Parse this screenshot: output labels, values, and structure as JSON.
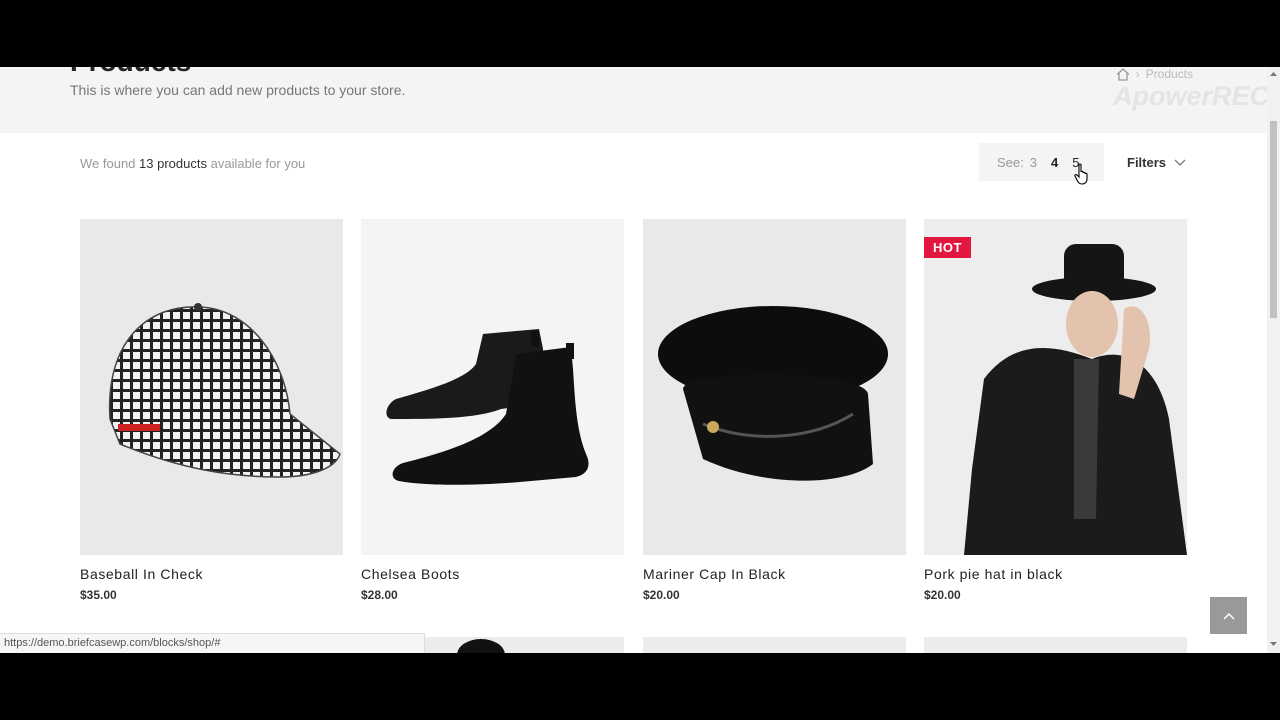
{
  "header": {
    "title": "Products",
    "subtitle": "This is where you can add new products to your store.",
    "breadcrumb": {
      "home_icon": "home-icon",
      "current": "Products"
    },
    "watermark": "ApowerREC"
  },
  "toolbar": {
    "found_prefix": "We found",
    "found_count": "13 products",
    "found_suffix": "available for you",
    "see_label": "See:",
    "see_options": [
      "3",
      "4",
      "5"
    ],
    "see_active": "4",
    "filters_label": "Filters"
  },
  "products": [
    {
      "name": "Baseball In Check",
      "price": "$35.00",
      "badge": ""
    },
    {
      "name": "Chelsea Boots",
      "price": "$28.00",
      "badge": ""
    },
    {
      "name": "Mariner Cap In Black",
      "price": "$20.00",
      "badge": ""
    },
    {
      "name": "Pork pie hat in black",
      "price": "$20.00",
      "badge": "HOT"
    }
  ],
  "status_bar": {
    "url": "https://demo.briefcasewp.com/blocks/shop/#"
  },
  "colors": {
    "badge": "#e1173f",
    "header_bg": "#f4f4f4",
    "image_bg": "#e9e9e9"
  }
}
